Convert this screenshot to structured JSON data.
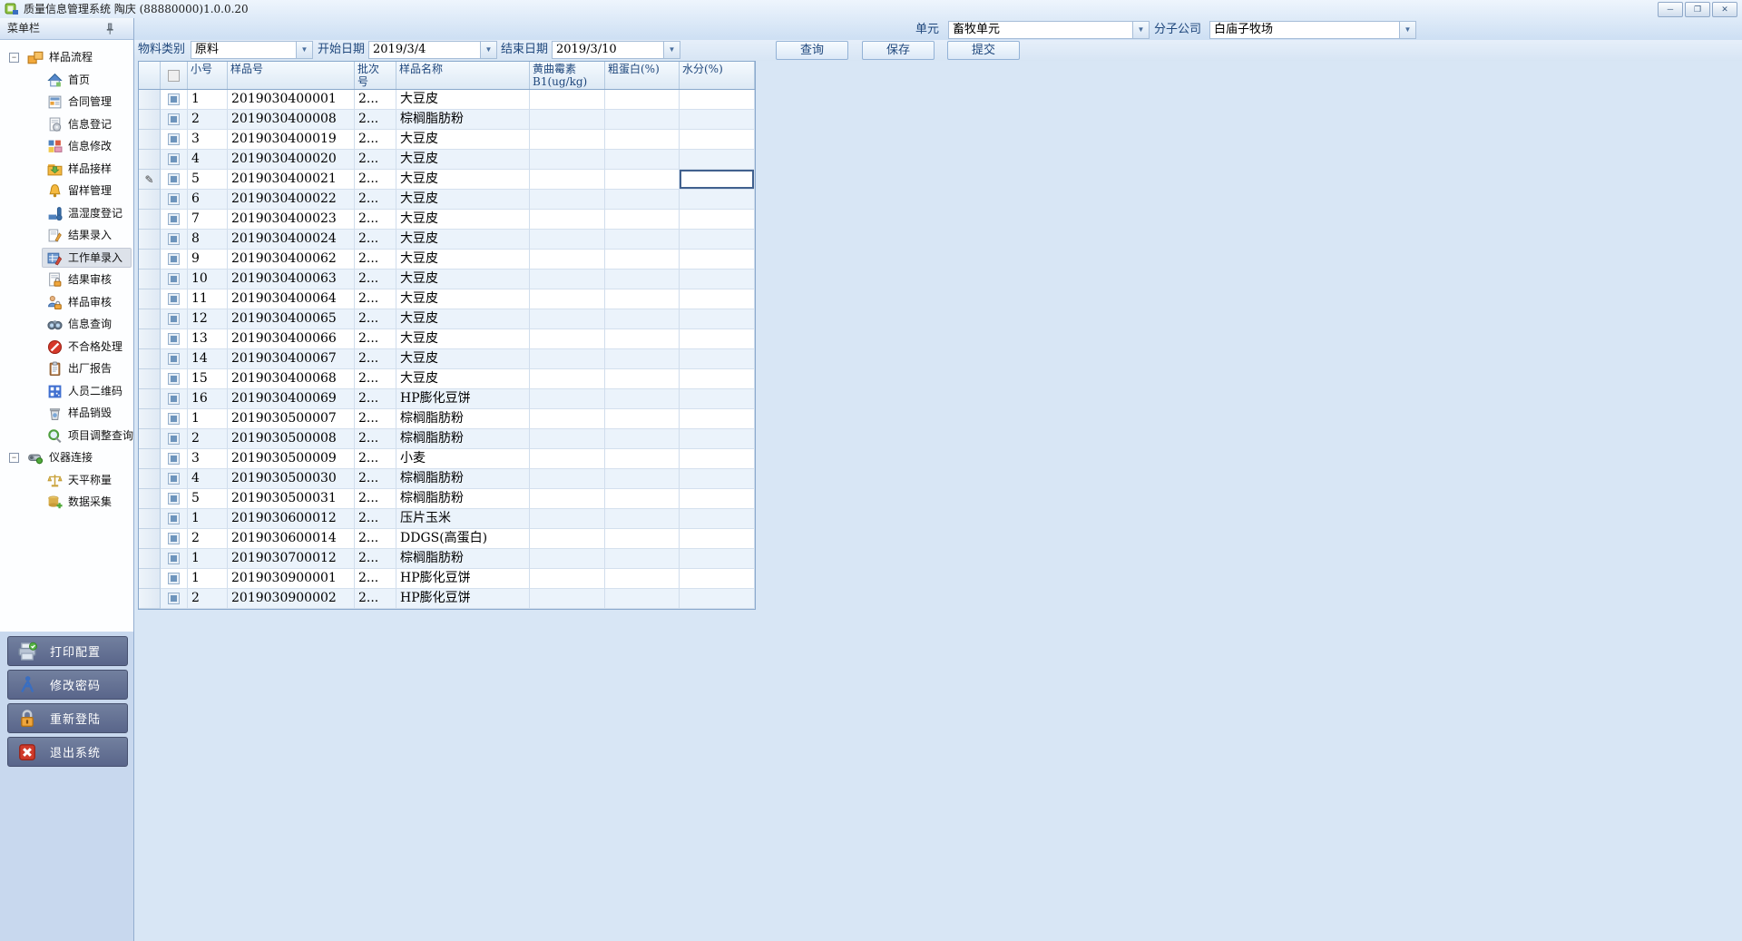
{
  "window": {
    "title": "质量信息管理系统  陶庆 (88880000)1.0.0.20",
    "app_icon": "app-logo",
    "controls": [
      {
        "name": "minimize-button",
        "glyph": "─"
      },
      {
        "name": "maximize-button",
        "glyph": "❐"
      },
      {
        "name": "close-button",
        "glyph": "✕"
      }
    ]
  },
  "top": {
    "unit_label": "单元",
    "unit_value": "畜牧单元",
    "branch_label": "分子公司",
    "branch_value": "白庙子牧场"
  },
  "toolbar": {
    "material_label": "物料类别",
    "material_value": "原料",
    "start_label": "开始日期",
    "start_value": "2019/3/4",
    "end_label": "结束日期",
    "end_value": "2019/3/10",
    "query_label": "查询",
    "save_label": "保存",
    "submit_label": "提交"
  },
  "sidebar": {
    "header": "菜单栏",
    "pin_icon": "pin",
    "expander_glyph": "−",
    "groups": [
      {
        "label": "样品流程",
        "icon": "sample-flow",
        "items": [
          {
            "label": "首页",
            "icon": "home"
          },
          {
            "label": "合同管理",
            "icon": "contract"
          },
          {
            "label": "信息登记",
            "icon": "info-register"
          },
          {
            "label": "信息修改",
            "icon": "info-modify"
          },
          {
            "label": "样品接样",
            "icon": "sample-receive"
          },
          {
            "label": "留样管理",
            "icon": "retain-manage"
          },
          {
            "label": "温湿度登记",
            "icon": "temp-humidity"
          },
          {
            "label": "结果录入",
            "icon": "result-entry"
          },
          {
            "label": "工作单录入",
            "icon": "worksheet-entry",
            "selected": true
          },
          {
            "label": "结果审核",
            "icon": "result-audit"
          },
          {
            "label": "样品审核",
            "icon": "sample-audit"
          },
          {
            "label": "信息查询",
            "icon": "info-query"
          },
          {
            "label": "不合格处理",
            "icon": "nonconform"
          },
          {
            "label": "出厂报告",
            "icon": "factory-report"
          },
          {
            "label": "人员二维码",
            "icon": "qrcode"
          },
          {
            "label": "样品销毁",
            "icon": "sample-destroy"
          },
          {
            "label": "项目调整查询",
            "icon": "project-adjust-query"
          }
        ]
      },
      {
        "label": "仪器连接",
        "icon": "instrument-connect",
        "items": [
          {
            "label": "天平称量",
            "icon": "balance-weigh"
          },
          {
            "label": "数据采集",
            "icon": "data-collect"
          }
        ]
      }
    ],
    "footer_buttons": [
      {
        "label": "打印配置",
        "icon": "printer"
      },
      {
        "label": "修改密码",
        "icon": "change-password"
      },
      {
        "label": "重新登陆",
        "icon": "relogin-lock"
      },
      {
        "label": "退出系统",
        "icon": "exit-system"
      }
    ]
  },
  "table": {
    "columns": [
      {
        "key": "sn",
        "label_lines": [
          "小号"
        ]
      },
      {
        "key": "sample_no",
        "label_lines": [
          "样品号"
        ]
      },
      {
        "key": "batch",
        "label_lines": [
          "批次",
          "号"
        ]
      },
      {
        "key": "name",
        "label_lines": [
          "样品名称"
        ]
      },
      {
        "key": "b1",
        "label_lines": [
          "黄曲霉素",
          "B1(ug/kg)"
        ]
      },
      {
        "key": "protein",
        "label_lines": [
          "粗蛋白(%)"
        ]
      },
      {
        "key": "moisture",
        "label_lines": [
          "水分(%)"
        ]
      }
    ],
    "edit_indicator_glyph": "✎",
    "focus": {
      "row_index": 4,
      "column": "moisture"
    },
    "rows": [
      {
        "sn": "1",
        "sample_no": "2019030400001",
        "batch": "2...",
        "name": "大豆皮"
      },
      {
        "sn": "2",
        "sample_no": "2019030400008",
        "batch": "2...",
        "name": "棕榈脂肪粉"
      },
      {
        "sn": "3",
        "sample_no": "2019030400019",
        "batch": "2...",
        "name": "大豆皮"
      },
      {
        "sn": "4",
        "sample_no": "2019030400020",
        "batch": "2...",
        "name": "大豆皮"
      },
      {
        "sn": "5",
        "sample_no": "2019030400021",
        "batch": "2...",
        "name": "大豆皮"
      },
      {
        "sn": "6",
        "sample_no": "2019030400022",
        "batch": "2...",
        "name": "大豆皮"
      },
      {
        "sn": "7",
        "sample_no": "2019030400023",
        "batch": "2...",
        "name": "大豆皮"
      },
      {
        "sn": "8",
        "sample_no": "2019030400024",
        "batch": "2...",
        "name": "大豆皮"
      },
      {
        "sn": "9",
        "sample_no": "2019030400062",
        "batch": "2...",
        "name": "大豆皮"
      },
      {
        "sn": "10",
        "sample_no": "2019030400063",
        "batch": "2...",
        "name": "大豆皮"
      },
      {
        "sn": "11",
        "sample_no": "2019030400064",
        "batch": "2...",
        "name": "大豆皮"
      },
      {
        "sn": "12",
        "sample_no": "2019030400065",
        "batch": "2...",
        "name": "大豆皮"
      },
      {
        "sn": "13",
        "sample_no": "2019030400066",
        "batch": "2...",
        "name": "大豆皮"
      },
      {
        "sn": "14",
        "sample_no": "2019030400067",
        "batch": "2...",
        "name": "大豆皮"
      },
      {
        "sn": "15",
        "sample_no": "2019030400068",
        "batch": "2...",
        "name": "大豆皮"
      },
      {
        "sn": "16",
        "sample_no": "2019030400069",
        "batch": "2...",
        "name": "HP膨化豆饼"
      },
      {
        "sn": "1",
        "sample_no": "2019030500007",
        "batch": "2...",
        "name": "棕榈脂肪粉"
      },
      {
        "sn": "2",
        "sample_no": "2019030500008",
        "batch": "2...",
        "name": "棕榈脂肪粉"
      },
      {
        "sn": "3",
        "sample_no": "2019030500009",
        "batch": "2...",
        "name": "小麦"
      },
      {
        "sn": "4",
        "sample_no": "2019030500030",
        "batch": "2...",
        "name": "棕榈脂肪粉"
      },
      {
        "sn": "5",
        "sample_no": "2019030500031",
        "batch": "2...",
        "name": "棕榈脂肪粉"
      },
      {
        "sn": "1",
        "sample_no": "2019030600012",
        "batch": "2...",
        "name": "压片玉米"
      },
      {
        "sn": "2",
        "sample_no": "2019030600014",
        "batch": "2...",
        "name": "DDGS(高蛋白)"
      },
      {
        "sn": "1",
        "sample_no": "2019030700012",
        "batch": "2...",
        "name": "棕榈脂肪粉"
      },
      {
        "sn": "1",
        "sample_no": "2019030900001",
        "batch": "2...",
        "name": "HP膨化豆饼"
      },
      {
        "sn": "2",
        "sample_no": "2019030900002",
        "batch": "2...",
        "name": "HP膨化豆饼"
      }
    ]
  },
  "colors": {
    "accent_blue": "#1f477c",
    "strip_top": "#eef5fd",
    "strip_bottom": "#cddff3",
    "footer_button": "#5f6b8e",
    "row_alt": "#ebf3fb",
    "grid_border": "#89a8cc"
  }
}
